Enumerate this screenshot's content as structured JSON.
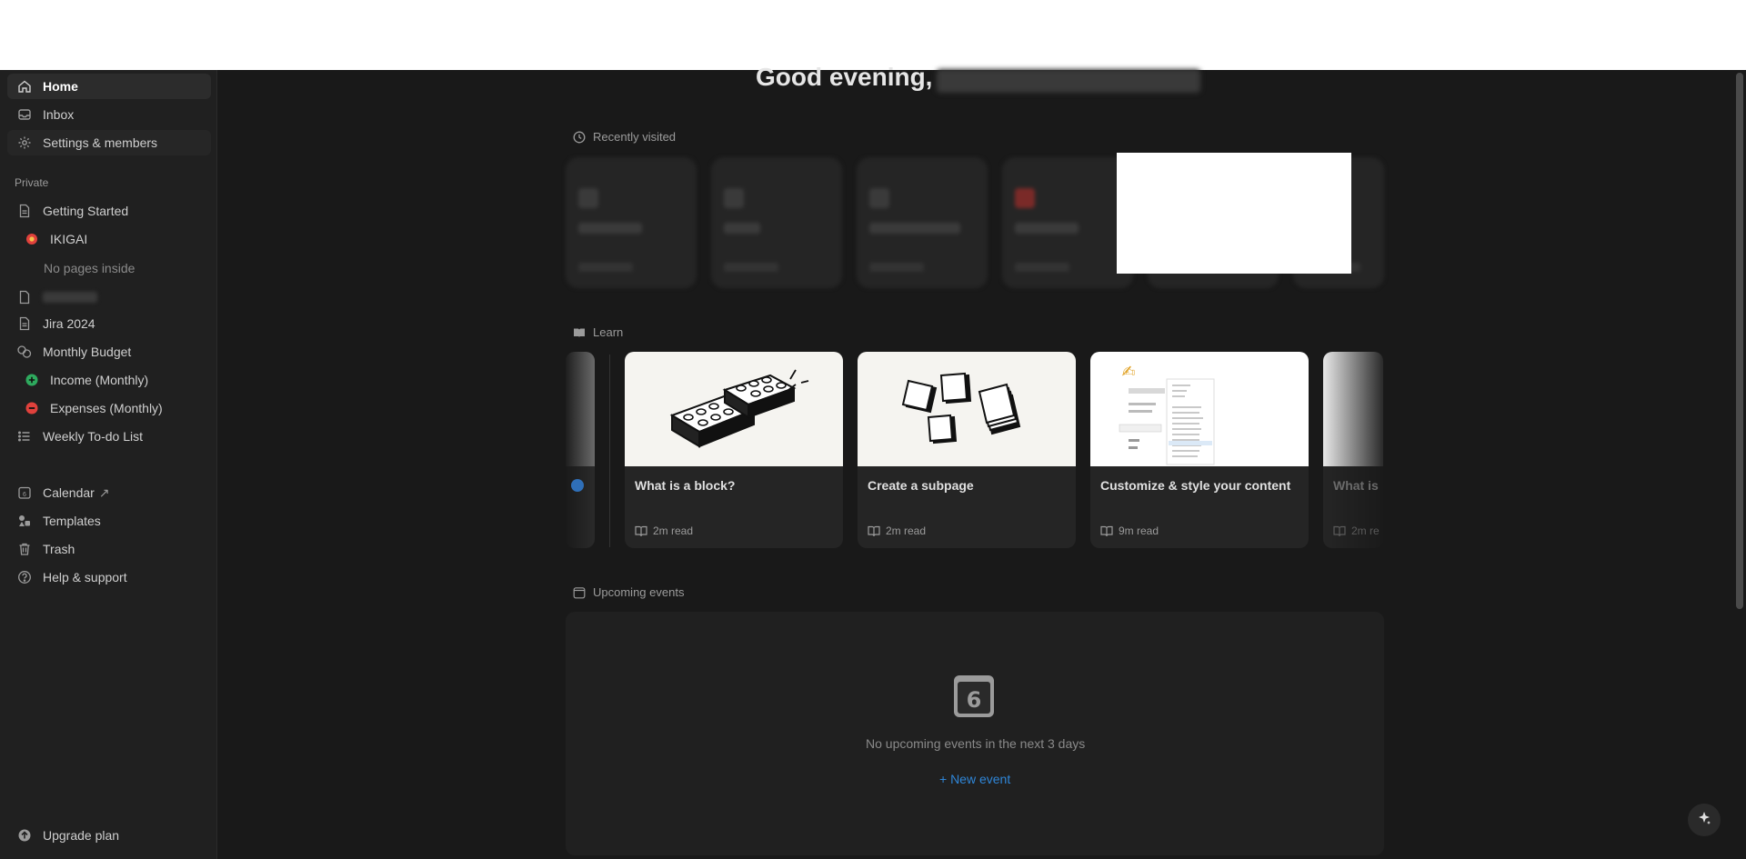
{
  "sidebar": {
    "top_items": [
      {
        "label": "Home",
        "icon": "home-icon"
      },
      {
        "label": "Inbox",
        "icon": "inbox-icon"
      },
      {
        "label": "Settings & members",
        "icon": "gear-icon"
      }
    ],
    "private_label": "Private",
    "pages": [
      {
        "label": "Getting Started",
        "icon": "page-icon"
      },
      {
        "label": "IKIGAI",
        "icon": "ikigai-emoji-icon"
      },
      {
        "label": "No pages inside"
      },
      {
        "label": "Jira 2024",
        "icon": "page-icon"
      },
      {
        "label": "Monthly Budget",
        "icon": "coins-icon"
      },
      {
        "label": "Income (Monthly)",
        "icon": "plus-circle-icon"
      },
      {
        "label": "Expenses (Monthly)",
        "icon": "minus-circle-icon"
      },
      {
        "label": "Weekly To-do List",
        "icon": "list-icon"
      }
    ],
    "bottom_items": [
      {
        "label": "Calendar",
        "icon": "calendar-icon",
        "suffix": "↗"
      },
      {
        "label": "Templates",
        "icon": "templates-icon"
      },
      {
        "label": "Trash",
        "icon": "trash-icon"
      },
      {
        "label": "Help & support",
        "icon": "help-icon"
      }
    ],
    "upgrade_label": "Upgrade plan"
  },
  "main": {
    "greeting": "Good evening,",
    "recently_visited_label": "Recently visited",
    "learn_label": "Learn",
    "learn_cards": [
      {
        "title": "What is a block?",
        "meta": "2m read"
      },
      {
        "title": "Create a subpage",
        "meta": "2m read"
      },
      {
        "title": "Customize & style your content",
        "meta": "9m read"
      },
      {
        "title": "What is",
        "meta": "2m re"
      }
    ],
    "upcoming_events_label": "Upcoming events",
    "calendar_day": "6",
    "no_events_text": "No upcoming events in the next 3 days",
    "new_event_label": "+ New event"
  },
  "colors": {
    "background": "#191919",
    "sidebar": "#202020",
    "accent_link": "#2f86d8",
    "income_green": "#2eaa5e",
    "expense_red": "#e0413c"
  }
}
